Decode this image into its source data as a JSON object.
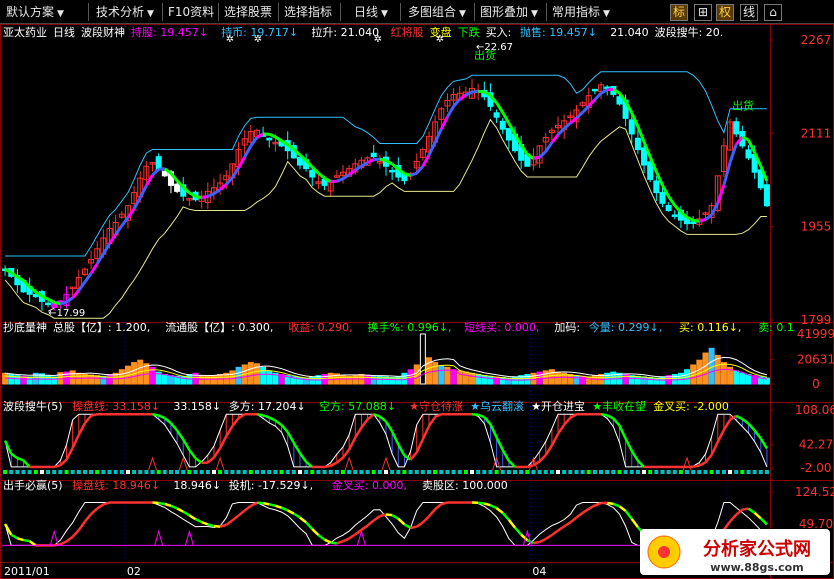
{
  "toolbar": {
    "buttons": [
      {
        "label": "默认方案",
        "dropdown": true
      },
      {
        "label": "技术分析",
        "dropdown": true
      },
      {
        "label": "F10资料",
        "dropdown": false
      },
      {
        "label": "选择股票",
        "dropdown": false
      },
      {
        "label": "选择指标",
        "dropdown": false
      },
      {
        "label": "日线",
        "dropdown": true
      },
      {
        "label": "多图组合",
        "dropdown": true
      },
      {
        "label": "图形叠加",
        "dropdown": true
      },
      {
        "label": "常用指标",
        "dropdown": true
      }
    ],
    "icons": [
      {
        "label": "标",
        "name": "mark-icon",
        "active": true
      },
      {
        "label": "⊞",
        "name": "grid-icon",
        "active": false
      },
      {
        "label": "权",
        "name": "rights-icon",
        "active": true
      },
      {
        "label": "线",
        "name": "line-icon",
        "active": false
      },
      {
        "label": "⌂",
        "name": "home-icon",
        "active": false
      }
    ]
  },
  "colors": {
    "up": "#ff3030",
    "down": "#00ffff",
    "ma": "#ffff00",
    "magenta": "#ff00ff",
    "green": "#00ff00",
    "white": "#ffffff",
    "axis": "#8b0000",
    "blue": "#4060ff",
    "sky": "#30c0ff"
  },
  "chart_data": [
    {
      "type": "candlestick",
      "panel": "main",
      "title_parts": [
        {
          "text": "亚太药业",
          "color": "#ffffff"
        },
        {
          "text": "日线",
          "color": "#ffffff"
        },
        {
          "text": "波段财神",
          "color": "#ffffff"
        },
        {
          "text": "持股: 19.457↓",
          "color": "#ff00ff"
        },
        {
          "text": "持币: 19.717↓",
          "color": "#30c0ff"
        },
        {
          "text": "拉升: 21.040",
          "color": "#ffffff"
        },
        {
          "text": "红将股",
          "color": "#ff3030"
        },
        {
          "text": "变盘",
          "color": "#ffff00"
        },
        {
          "text": "下跌",
          "color": "#00ff00"
        },
        {
          "text": "买入:",
          "color": "#ffffff"
        },
        {
          "text": "抛售: 19.457↓",
          "color": "#30c0ff"
        },
        {
          "text": "21.040",
          "color": "#ffffff"
        },
        {
          "text": "波段搜牛: 20.",
          "color": "#ffffff"
        }
      ],
      "y_ticks": [
        "2267",
        "2111",
        "1955",
        "1799"
      ],
      "ylim": [
        1799,
        2267
      ],
      "annotations": [
        {
          "text": "17.99",
          "x_index": 8,
          "value": 1812
        },
        {
          "text": "22.67",
          "x_index": 76,
          "value": 2267
        },
        {
          "text": "出货",
          "x_index": 76,
          "value": 2235
        },
        {
          "text": "出货",
          "x_index": 118,
          "value": 2151
        }
      ],
      "close": [
        1884,
        1872,
        1858,
        1846,
        1842,
        1838,
        1830,
        1826,
        1820,
        1828,
        1842,
        1854,
        1870,
        1884,
        1900,
        1918,
        1936,
        1952,
        1962,
        1976,
        1990,
        2012,
        2036,
        2056,
        2062,
        2050,
        2040,
        2024,
        2014,
        2006,
        2002,
        2000,
        2006,
        2014,
        2020,
        2028,
        2040,
        2060,
        2084,
        2102,
        2114,
        2116,
        2108,
        2100,
        2096,
        2090,
        2082,
        2070,
        2058,
        2052,
        2038,
        2030,
        2024,
        2030,
        2040,
        2046,
        2052,
        2060,
        2066,
        2070,
        2072,
        2064,
        2056,
        2048,
        2038,
        2032,
        2044,
        2064,
        2084,
        2106,
        2130,
        2152,
        2166,
        2176,
        2178,
        2180,
        2186,
        2182,
        2172,
        2156,
        2138,
        2118,
        2100,
        2082,
        2066,
        2056,
        2072,
        2090,
        2104,
        2116,
        2124,
        2132,
        2140,
        2150,
        2162,
        2174,
        2184,
        2192,
        2186,
        2176,
        2160,
        2136,
        2110,
        2084,
        2058,
        2034,
        2012,
        1994,
        1982,
        1974,
        1966,
        1960,
        1962,
        1968,
        1978,
        1990,
        2040,
        2090,
        2130,
        2110,
        2090,
        2070,
        2046,
        2020,
        1990
      ],
      "series": [
        {
          "name": "持股",
          "color": "#ff00ff"
        },
        {
          "name": "持币",
          "color": "#30c0ff"
        },
        {
          "name": "拉升",
          "color": "#ffffff"
        }
      ]
    },
    {
      "type": "bar",
      "panel": "volume",
      "title_parts": [
        {
          "text": "抄底量神",
          "color": "#ffffff"
        },
        {
          "text": "总股【亿】: 1.200,",
          "color": "#ffffff"
        },
        {
          "text": "流通股【亿】: 0.300,",
          "color": "#ffffff"
        },
        {
          "text": "收益: 0.290,",
          "color": "#ff3030"
        },
        {
          "text": "换手%: 0.996↓,",
          "color": "#00ff00"
        },
        {
          "text": "短线买: 0.000,",
          "color": "#ff00ff"
        },
        {
          "text": "加码:",
          "color": "#ffffff"
        },
        {
          "text": "今量: 0.299↓,",
          "color": "#30c0ff"
        },
        {
          "text": "买: 0.116↓,",
          "color": "#ffff00"
        },
        {
          "text": "卖: 0.1",
          "color": "#00ff00"
        }
      ],
      "y_ticks": [
        "41999",
        "20631",
        "0"
      ],
      "ylim": [
        0,
        41999
      ],
      "values": [
        9000,
        8000,
        7000,
        6500,
        6000,
        9000,
        8500,
        7000,
        6000,
        9500,
        10000,
        11000,
        9000,
        8000,
        7500,
        7000,
        6500,
        8000,
        9000,
        12000,
        15000,
        18000,
        20000,
        17000,
        14000,
        10000,
        8000,
        7000,
        6500,
        6000,
        8000,
        9000,
        7000,
        6500,
        7000,
        8000,
        9000,
        11000,
        14000,
        16000,
        18000,
        17000,
        14000,
        11000,
        9000,
        8000,
        7000,
        6000,
        5500,
        5000,
        6000,
        7000,
        8000,
        9000,
        8500,
        7000,
        6500,
        7000,
        8000,
        7500,
        7000,
        6500,
        6000,
        5500,
        6000,
        9000,
        12000,
        16000,
        41999,
        22000,
        18000,
        15000,
        14000,
        12000,
        11000,
        10000,
        9000,
        8000,
        7000,
        6500,
        6000,
        5500,
        5000,
        6000,
        7000,
        8000,
        9000,
        10000,
        11000,
        12000,
        10000,
        9000,
        8000,
        7000,
        6500,
        6000,
        7000,
        8000,
        9000,
        10000,
        9000,
        8000,
        7000,
        6500,
        6000,
        5500,
        5000,
        6000,
        7000,
        8000,
        9000,
        12000,
        16000,
        20000,
        26000,
        30000,
        24000,
        18000,
        14000,
        11000,
        9000,
        8000,
        7000,
        6000,
        5000
      ]
    },
    {
      "type": "line",
      "panel": "band",
      "title_parts": [
        {
          "text": "波段搜牛(5)",
          "color": "#ffffff"
        },
        {
          "text": "操盘线: 33.158↓",
          "color": "#ff3030"
        },
        {
          "text": "33.158↓",
          "color": "#ffffff"
        },
        {
          "text": "多方: 17.204↓",
          "color": "#ffffff"
        },
        {
          "text": "空方: 57.088↓",
          "color": "#00ff00"
        },
        {
          "text": "★守仓待涨",
          "color": "#ff3030"
        },
        {
          "text": "★乌云翻滚",
          "color": "#30c0ff"
        },
        {
          "text": "★开仓进宝",
          "color": "#ffffff"
        },
        {
          "text": "★丰收在望",
          "color": "#00ff00"
        },
        {
          "text": "金叉买: -2.000",
          "color": "#ffff00"
        }
      ],
      "y_ticks": [
        "108.06",
        "42.27",
        "-2.00"
      ],
      "ylim": [
        -2,
        108.06
      ]
    },
    {
      "type": "line",
      "panel": "signal",
      "title_parts": [
        {
          "text": "出手必赢(5)",
          "color": "#ffffff"
        },
        {
          "text": "操盘线: 18.946↓",
          "color": "#ff3030"
        },
        {
          "text": "18.946↓",
          "color": "#ffffff"
        },
        {
          "text": "投机: -17.529↓,",
          "color": "#ffffff"
        },
        {
          "text": "金叉买: 0.000,",
          "color": "#ff00ff"
        },
        {
          "text": "卖股区: 100.000",
          "color": "#ffffff"
        }
      ],
      "y_ticks": [
        "124.52",
        "49.70"
      ],
      "ylim": [
        -20,
        124.52
      ]
    }
  ],
  "x_axis": {
    "labels": [
      {
        "text": "2011/01",
        "index": 0
      },
      {
        "text": "02",
        "index": 20
      },
      {
        "text": "04",
        "index": 86
      },
      {
        "text": "05",
        "index": 118
      }
    ]
  },
  "watermark": {
    "text": "分析家公式网",
    "url": "www.88gs.com"
  }
}
